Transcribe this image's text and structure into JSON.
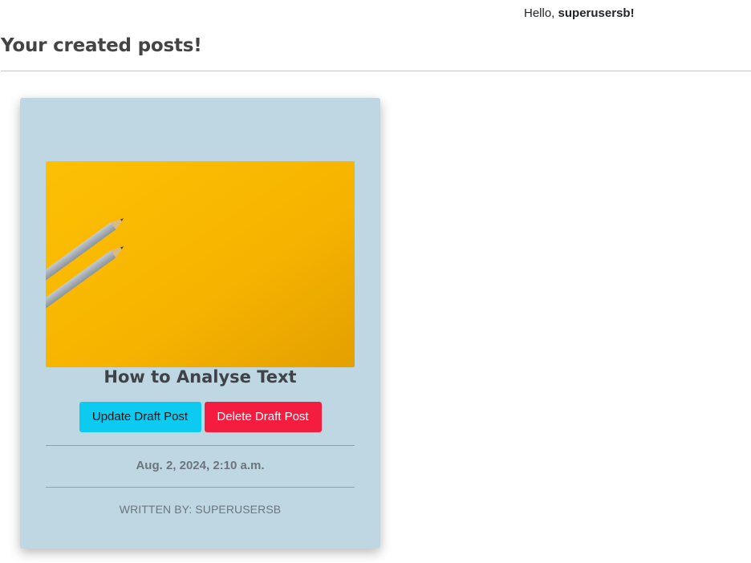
{
  "header": {
    "greeting_prefix": "Hello,",
    "username": "superusersb!"
  },
  "page": {
    "title": "Your created posts!"
  },
  "posts": [
    {
      "title": "How to Analyse Text",
      "image": "pencils-on-yellow-background",
      "update_label": "Update Draft Post",
      "delete_label": "Delete Draft Post",
      "date": "Aug. 2, 2024, 2:10 a.m.",
      "author_line": "WRITTEN BY: SUPERUSERSB"
    }
  ],
  "colors": {
    "card_background": "#bfd7e3",
    "update_button": "#0dcaf0",
    "delete_button": "#f41d40",
    "image_background": "#f7b500"
  }
}
